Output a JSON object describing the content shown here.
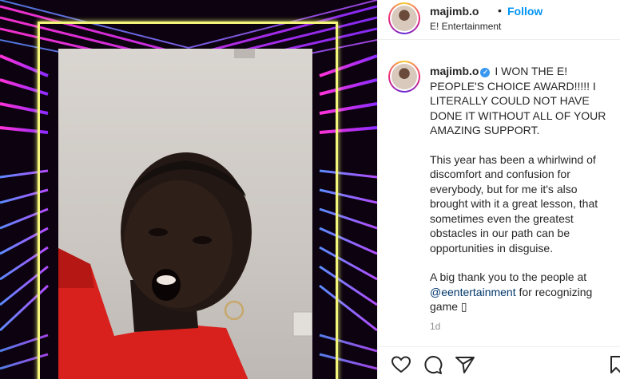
{
  "header": {
    "username": "majimb.o",
    "separator": "•",
    "follow_label": "Follow",
    "subtitle": "E! Entertainment"
  },
  "caption": {
    "username": "majimb.o",
    "paragraph1": "I WON THE E! PEOPLE'S CHOICE AWARD!!!!! I LITERALLY COULD NOT HAVE DONE IT WITHOUT ALL OF YOUR AMAZING SUPPORT.",
    "paragraph2": "This year has been a whirlwind of discomfort and confusion for everybody, but for me it's also brought with it a great lesson, that sometimes even the greatest obstacles in our path can be opportunities in disguise.",
    "paragraph3_prefix": "A big thank you to the people at",
    "mention": "@eentertainment",
    "paragraph3_suffix": "for recognizing game ▯",
    "time": "1d"
  },
  "actions": {
    "icons": [
      "heart-icon",
      "comment-icon",
      "share-icon",
      "bookmark-icon"
    ]
  },
  "colors": {
    "follow": "#0095f6",
    "frame": "#f2f57a",
    "neon_pink": "#ff2fd0",
    "neon_blue": "#3f7bff",
    "shirt": "#d8201c"
  }
}
